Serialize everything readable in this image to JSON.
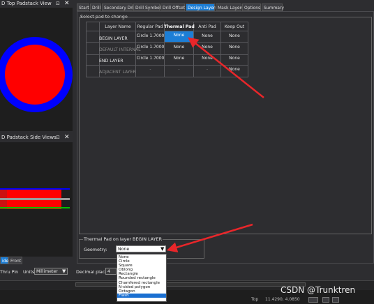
{
  "top_view": {
    "title": "D Top Padstack View"
  },
  "side_view": {
    "title": "D Padstack Side Views"
  },
  "side_tabs": [
    "ide",
    "Front"
  ],
  "bottom_bar": {
    "type_label": "Thru Pin",
    "units_label": "Units:",
    "units_value": "Millimeter",
    "decimal_label": "Decimal places:",
    "decimal_value": "4"
  },
  "tabs": [
    "Start",
    "Drill",
    "Secondary Drill",
    "Drill Symbol",
    "Drill Offset",
    "Design Layers",
    "Mask Layers",
    "Options",
    "Summary"
  ],
  "active_tab": "Design Layers",
  "group_title": "Select pad to change",
  "table": {
    "headers": [
      "Layer Name",
      "Regular Pad",
      "Thermal Pad",
      "Anti Pad",
      "Keep Out"
    ],
    "rows": [
      {
        "layer": "BEGIN LAYER",
        "regular": "Circle 1.7000",
        "thermal": "None",
        "anti": "None",
        "keep": "None"
      },
      {
        "layer": "DEFAULT INTERNAL",
        "regular": "Circle 1.7000",
        "thermal": "None",
        "anti": "None",
        "keep": "None"
      },
      {
        "layer": "END LAYER",
        "regular": "Circle 1.7000",
        "thermal": "None",
        "anti": "None",
        "keep": "None"
      },
      {
        "layer": "ADJACENT LAYER",
        "regular": "-",
        "thermal": "-",
        "anti": "-",
        "keep": "None"
      }
    ]
  },
  "thermal_group": {
    "title": "Thermal Pad on layer BEGIN LAYER",
    "geometry_label": "Geometry:",
    "geometry_value": "None"
  },
  "dropdown_options": [
    "None",
    "Circle",
    "Square",
    "Oblong",
    "Rectangle",
    "Rounded rectangle",
    "Chamfered rectangle",
    "N-sided polygon",
    "Octagon",
    "Flash"
  ],
  "dropdown_selected": "Flash",
  "status": {
    "text": "Top",
    "coords": "11.4290, 4.0850"
  },
  "watermark": "CSDN @Trunktren",
  "colors": {
    "accent": "#1c7ed6",
    "arrow": "#e8262a",
    "pad_red": "#ff0000",
    "pad_blue": "#0000ff",
    "green": "#00c000"
  }
}
